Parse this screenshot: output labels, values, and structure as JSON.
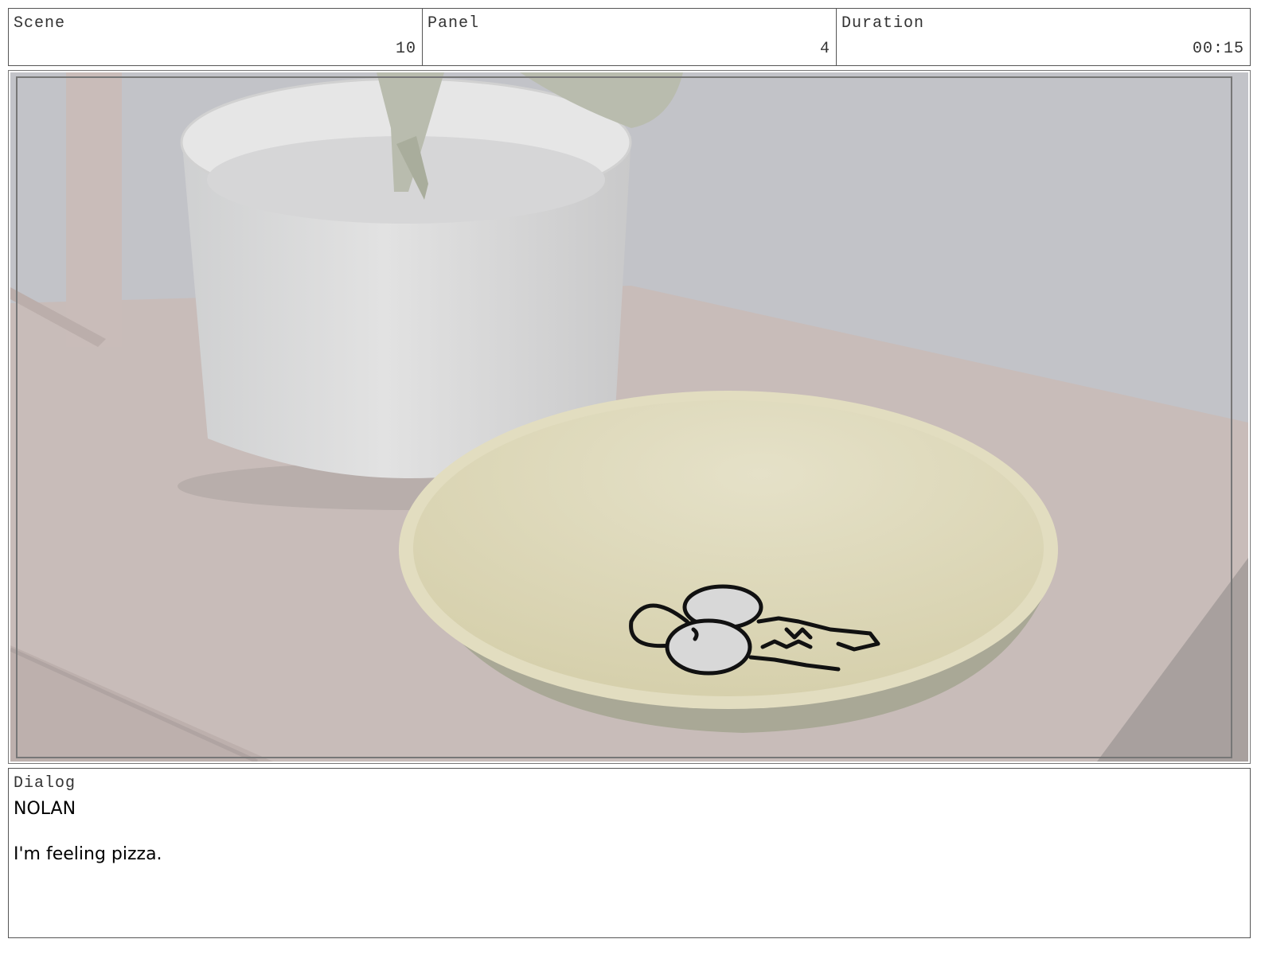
{
  "header": {
    "scene": {
      "label": "Scene",
      "value": "10"
    },
    "panel": {
      "label": "Panel",
      "value": "4"
    },
    "duration": {
      "label": "Duration",
      "value": "00:15"
    }
  },
  "frame": {
    "illustration": "3D render of a white planter pot with plant leaves and a cream bowl on a pink tabletop; a hand-drawn sketch of keys on a ring rests in the bowl",
    "icons": [
      "keys-sketch-icon"
    ],
    "colors": {
      "wall": "#c2c3c8",
      "table": "#c7bbb8",
      "pot": "#dcdcdb",
      "bowl": "#e0dcc2",
      "leaves": "#b9bcae"
    }
  },
  "dialog": {
    "label": "Dialog",
    "speaker": "NOLAN",
    "line": "I'm feeling pizza."
  }
}
